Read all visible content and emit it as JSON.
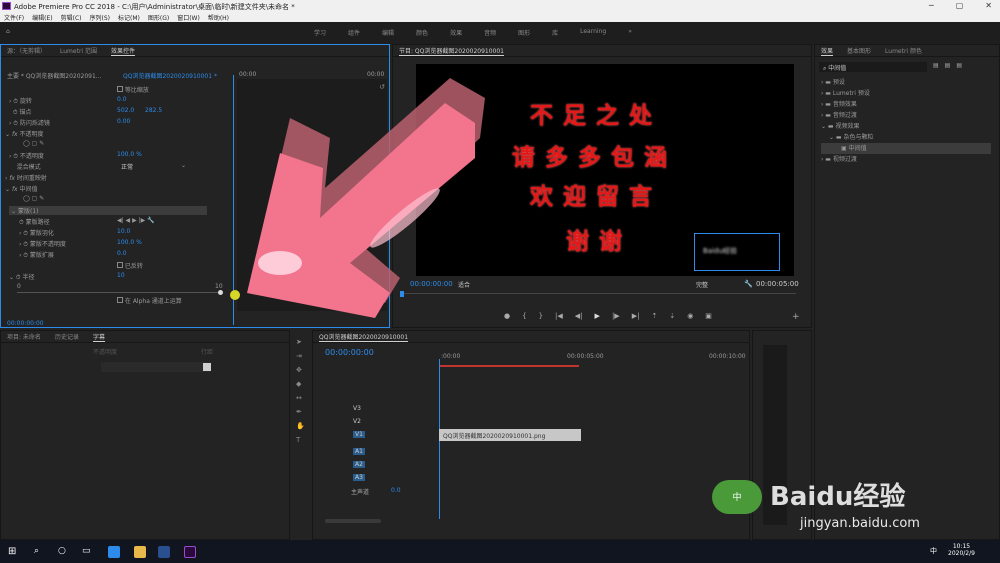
{
  "window": {
    "title": "Adobe Premiere Pro CC 2018 - C:\\用户\\Administrator\\桌面\\临时\\新建文件夹\\未命名 *"
  },
  "menu": [
    "文件(F)",
    "编辑(E)",
    "剪辑(C)",
    "序列(S)",
    "标记(M)",
    "图形(G)",
    "窗口(W)",
    "帮助(H)"
  ],
  "workspaces": [
    "学习",
    "组件",
    "编辑",
    "颜色",
    "效果",
    "音频",
    "图形",
    "库",
    "Learning"
  ],
  "left_panel": {
    "tabs": [
      "源：（无剪辑）",
      "Lumetri 范围",
      "效果控件"
    ],
    "clip_main": "主要 * QQ浏览器截图20202091...",
    "clip_seq": "QQ浏览器截图2020020910001 *",
    "time_start": "00:00",
    "time_end": "00:00",
    "uniform_scale": "等比缩放",
    "rows": [
      {
        "label": "旋转",
        "value": "0.0"
      },
      {
        "label": "锚点",
        "value": "502.0",
        "value2": "282.5"
      },
      {
        "label": "防闪烁滤镜",
        "value": "0.00"
      },
      {
        "label": "不透明度",
        "value": ""
      },
      {
        "label": "不透明度",
        "value": "100.0 %"
      },
      {
        "label": "混合模式",
        "value": "正常"
      },
      {
        "label": "时间重映射",
        "value": ""
      },
      {
        "label": "中间值",
        "value": ""
      },
      {
        "label": "蒙版(1)",
        "value": ""
      },
      {
        "label": "蒙版路径",
        "value": ""
      },
      {
        "label": "蒙版羽化",
        "value": "10.0"
      },
      {
        "label": "蒙版不透明度",
        "value": "100.0 %"
      },
      {
        "label": "蒙版扩展",
        "value": "0.0"
      },
      {
        "label": "已反转",
        "value": ""
      },
      {
        "label": "半径",
        "value": "10"
      }
    ],
    "slider_min": "0",
    "slider_max": "10",
    "alpha_option": "在 Alpha 通道上运算",
    "timecode": "00:00:00:00"
  },
  "program": {
    "title": "节目: QQ浏览器截图2020020910001",
    "lines": [
      "不足之处",
      "请多多包涵",
      "欢迎留言",
      "谢谢"
    ],
    "blur_text": "Baidu经验",
    "timecode": "00:00:00:00",
    "fit": "适合",
    "quality": "完整",
    "duration": "00:00:05:00"
  },
  "project_panel": {
    "tabs": [
      "项目: 未命名",
      "历史记录",
      "字幕"
    ],
    "placeholders": [
      "不透明度",
      "行距"
    ]
  },
  "timeline": {
    "sequence": "QQ浏览器截图2020020910001",
    "timecode": "00:00:00:00",
    "ruler": [
      ":00:00",
      "00:00:05:00",
      "00:00:10:00"
    ],
    "video_tracks": [
      "V3",
      "V2",
      "V1"
    ],
    "audio_tracks": [
      "A1",
      "A2",
      "A3"
    ],
    "clip_name": "QQ浏览器截图2020020910001.png",
    "master": "主声道",
    "master_value": "0.0"
  },
  "effects_panel": {
    "tabs": [
      "效果",
      "基本图形",
      "Lumetri 颜色"
    ],
    "search": "中间值",
    "tree": [
      "预设",
      "Lumetri 预设",
      "音频效果",
      "音频过渡",
      "视频效果",
      "杂色与颗粒",
      "中间值",
      "视频过渡"
    ]
  },
  "watermark": {
    "logo": "Baidu经验",
    "url": "jingyan.baidu.com",
    "badge": "中"
  },
  "taskbar": {
    "time": "10:15",
    "date": "2020/2/9",
    "lang": "中"
  },
  "colors": {
    "accent": "#2d8ceb",
    "text_red": "#e31818",
    "arrow_pink": "#f2758d"
  }
}
